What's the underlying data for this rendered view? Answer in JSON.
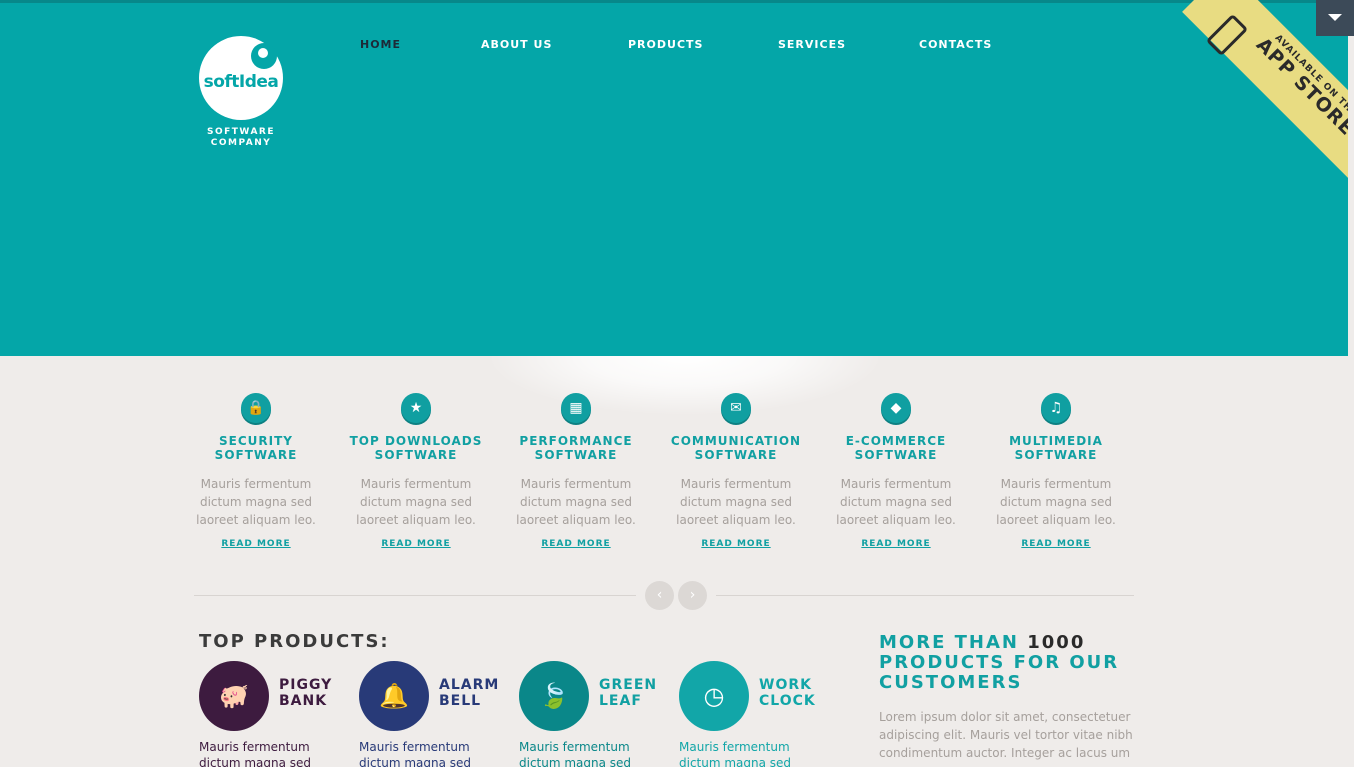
{
  "brand": {
    "name": "softIdea",
    "tagline_line1": "SOFTWARE",
    "tagline_line2": "COMPANY"
  },
  "nav": {
    "items": [
      "HOME",
      "ABOUT US",
      "PRODUCTS",
      "SERVICES",
      "CONTACTS"
    ],
    "active_index": 0
  },
  "ribbon": {
    "line1": "AVAILABLE ON THE",
    "line2": "APP STORE",
    "icon": "phone-icon"
  },
  "features": [
    {
      "icon": "lock-icon",
      "glyph": "🔒",
      "title_line1": "SECURITY",
      "title_line2": "SOFTWARE",
      "desc": "Mauris fermentum dictum magna sed laoreet aliquam leo.",
      "link": "READ MORE"
    },
    {
      "icon": "star-icon",
      "glyph": "★",
      "title_line1": "TOP DOWNLOADS",
      "title_line2": "SOFTWARE",
      "desc": "Mauris fermentum dictum magna sed laoreet aliquam leo.",
      "link": "READ MORE"
    },
    {
      "icon": "film-icon",
      "glyph": "▦",
      "title_line1": "PERFORMANCE",
      "title_line2": "SOFTWARE",
      "desc": "Mauris fermentum dictum magna sed laoreet aliquam leo.",
      "link": "READ MORE"
    },
    {
      "icon": "chat-icon",
      "glyph": "✉",
      "title_line1": "COMMUNICATION",
      "title_line2": "SOFTWARE",
      "desc": "Mauris fermentum dictum magna sed laoreet aliquam leo.",
      "link": "READ MORE"
    },
    {
      "icon": "tag-icon",
      "glyph": "◆",
      "title_line1": "E-COMMERCE",
      "title_line2": "SOFTWARE",
      "desc": "Mauris fermentum dictum magna sed laoreet aliquam leo.",
      "link": "READ MORE"
    },
    {
      "icon": "music-icon",
      "glyph": "♫",
      "title_line1": "MULTIMEDIA",
      "title_line2": "SOFTWARE",
      "desc": "Mauris fermentum dictum magna sed laoreet aliquam leo.",
      "link": "READ MORE"
    }
  ],
  "slider": {
    "prev": "‹",
    "next": "›"
  },
  "top_products": {
    "heading": "TOP PRODUCTS:",
    "items": [
      {
        "icon": "piggy-bank-icon",
        "glyph": "🐖",
        "name_line1": "PIGGY",
        "name_line2": "BANK",
        "color": "#3d1b3f",
        "text_color": "#3d1b3f",
        "desc": "Mauris fermentum dictum magna sed"
      },
      {
        "icon": "bell-icon",
        "glyph": "🔔",
        "name_line1": "ALARM",
        "name_line2": "BELL",
        "color": "#283a78",
        "text_color": "#283a78",
        "desc": "Mauris fermentum dictum magna sed"
      },
      {
        "icon": "leaf-icon",
        "glyph": "🍃",
        "name_line1": "GREEN",
        "name_line2": "LEAF",
        "color": "#0a8789",
        "text_color": "#0a8789",
        "desc": "Mauris fermentum dictum magna sed"
      },
      {
        "icon": "clock-icon",
        "glyph": "◷",
        "name_line1": "WORK",
        "name_line2": "CLOCK",
        "color": "#12a6a8",
        "text_color": "#12a6a8",
        "desc": "Mauris fermentum dictum magna sed"
      }
    ]
  },
  "promo": {
    "title_part1": "MORE THAN ",
    "title_number": "1000",
    "title_part2": "PRODUCTS FOR OUR CUSTOMERS",
    "text": "Lorem ipsum dolor sit amet, consectetuer adipiscing elit. Mauris vel tortor vitae nibh condimentum auctor. Integer ac lacus um"
  },
  "colors": {
    "primary": "#04a6a8",
    "accent": "#11a0a2",
    "background": "#efecea",
    "ribbon": "#e8dc82"
  }
}
